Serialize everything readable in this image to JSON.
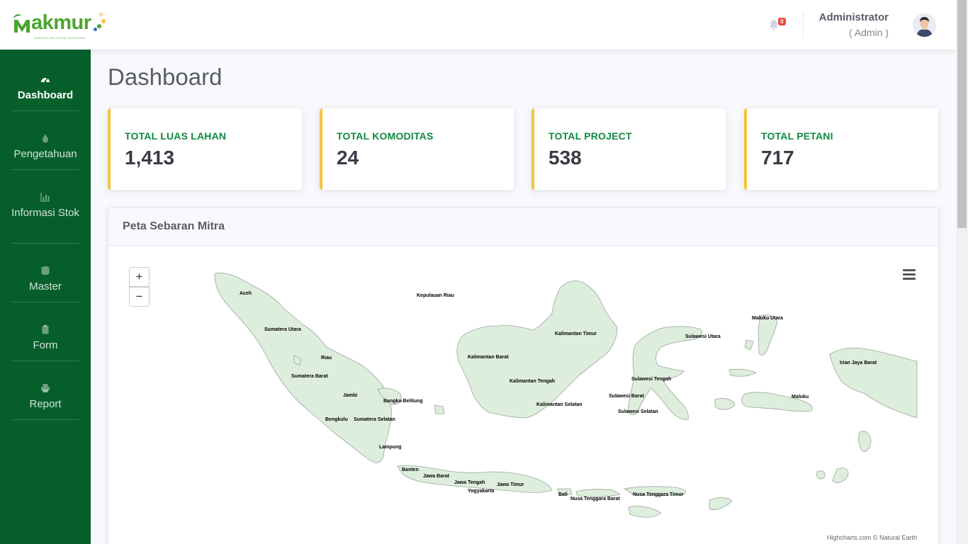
{
  "brand": {
    "name": "Makmur",
    "tagline": "AGROSOLUSI PUPUK INDONESIA"
  },
  "topbar": {
    "notification_count": "0",
    "user_name": "Administrator",
    "user_role": "( Admin )"
  },
  "sidebar": {
    "items": [
      {
        "label": "Dashboard",
        "icon": "gauge-icon",
        "active": true
      },
      {
        "label": "Pengetahuan",
        "icon": "droplet-icon",
        "active": false
      },
      {
        "label": "Informasi Stok",
        "icon": "chart-icon",
        "active": false
      },
      {
        "label": "Master",
        "icon": "database-icon",
        "active": false
      },
      {
        "label": "Form",
        "icon": "clipboard-icon",
        "active": false
      },
      {
        "label": "Report",
        "icon": "printer-icon",
        "active": false
      }
    ]
  },
  "page": {
    "title": "Dashboard"
  },
  "cards": [
    {
      "label": "TOTAL LUAS LAHAN",
      "value": "1,413"
    },
    {
      "label": "TOTAL KOMODITAS",
      "value": "24"
    },
    {
      "label": "TOTAL PROJECT",
      "value": "538"
    },
    {
      "label": "TOTAL PETANI",
      "value": "717"
    }
  ],
  "map": {
    "title": "Peta Sebaran Mitra",
    "zoom_in": "+",
    "zoom_out": "−",
    "credits": "Highcharts.com © Natural Earth",
    "fill_color": "#deeedd",
    "regions": [
      "Aceh",
      "Sumatera Utara",
      "Riau",
      "Kepulauan Riau",
      "Sumatera Barat",
      "Jambi",
      "Bangka-Belitung",
      "Bengkulu",
      "Sumatera Selatan",
      "Lampung",
      "Banten",
      "Jawa Barat",
      "Jawa Tengah",
      "Yogyakarta",
      "Jawa Timur",
      "Bali",
      "Nusa Tenggara Barat",
      "Nusa Tenggara Timur",
      "Kalimantan Barat",
      "Kalimantan Tengah",
      "Kalimantan Selatan",
      "Kalimantan Timur",
      "Sulawesi Utara",
      "Sulawesi Tengah",
      "Sulawesi Barat",
      "Sulawesi Selatan",
      "Maluku Utara",
      "Maluku",
      "Irian Jaya Barat"
    ]
  },
  "colors": {
    "sidebar": "#065f2b",
    "card_accent": "#f6c23e",
    "card_label": "#0e8a3c"
  }
}
